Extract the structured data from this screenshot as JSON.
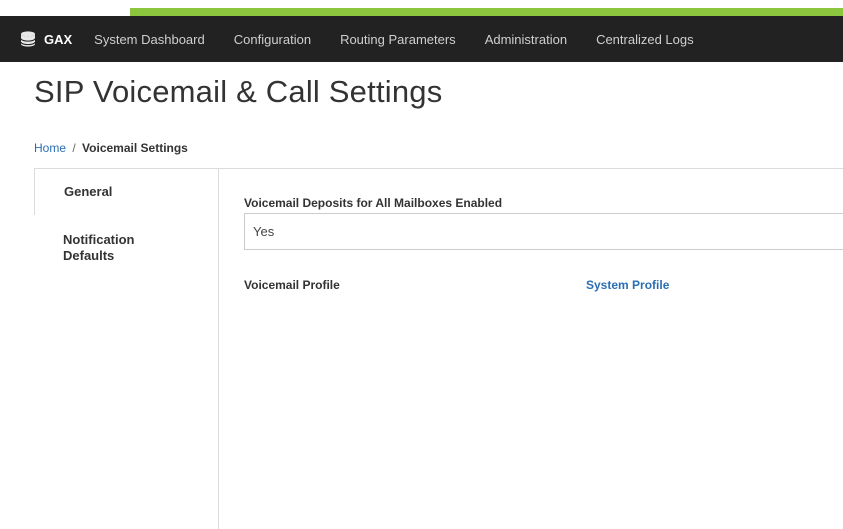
{
  "topnav": {
    "brand": "GAX",
    "brand_icon": "database-icon",
    "items": [
      {
        "label": "System Dashboard"
      },
      {
        "label": "Configuration"
      },
      {
        "label": "Routing Parameters"
      },
      {
        "label": "Administration"
      },
      {
        "label": "Centralized Logs"
      }
    ]
  },
  "page": {
    "title": "SIP Voicemail & Call Settings"
  },
  "breadcrumb": {
    "home": "Home",
    "separator": "/",
    "current": "Voicemail Settings"
  },
  "tabs": [
    {
      "label": "General",
      "active": true
    },
    {
      "label": "Notification Defaults",
      "active": false
    }
  ],
  "general": {
    "deposits_label": "Voicemail Deposits for All Mailboxes Enabled",
    "deposits_value": "Yes",
    "profile_label": "Voicemail Profile",
    "profile_value": "System Profile"
  },
  "colors": {
    "accent": "#8cc63f",
    "nav_bg": "#222222",
    "link": "#2a6fb4"
  }
}
